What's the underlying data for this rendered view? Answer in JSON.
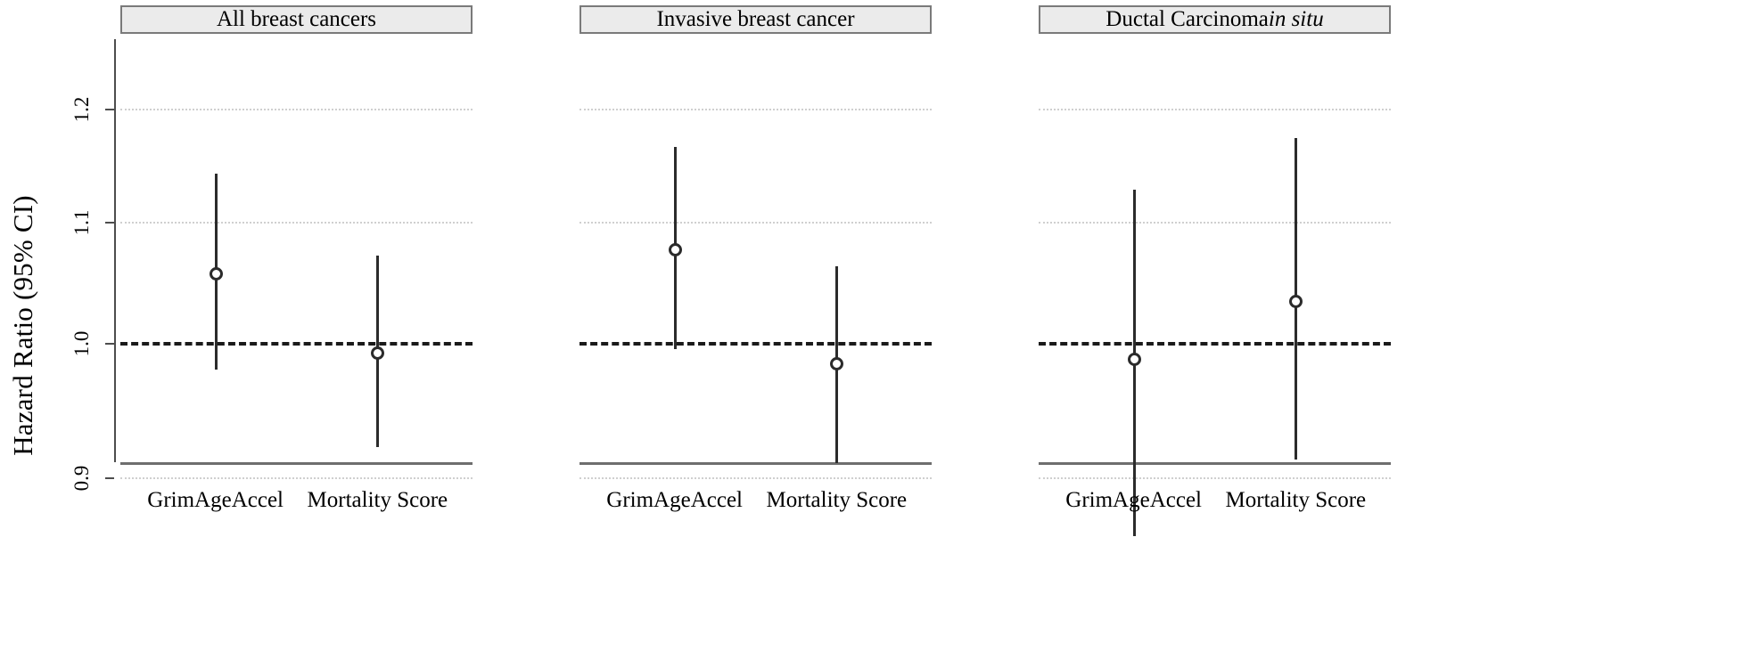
{
  "axis": {
    "ylabel": "Hazard Ratio (95% CI)",
    "yticks": [
      "1.2",
      "1.1",
      "1.0",
      "0.9"
    ],
    "ytick_values": [
      1.2,
      1.1,
      1.0,
      0.9
    ],
    "reference_line": 1.0,
    "reference_line_style": "dashed",
    "gridline_style": "dotted"
  },
  "panels": [
    {
      "id": "all-breast-cancers",
      "title_plain": "All breast cancers",
      "title_html": "All breast cancers"
    },
    {
      "id": "invasive-breast-cancer",
      "title_plain": "Invasive breast cancer",
      "title_html": "Invasive breast cancer"
    },
    {
      "id": "ductal-carcinoma-in-situ",
      "title_plain": "Ductal Carcinoma in situ",
      "title_html": "Ductal Carcinoma <em>in situ</em>"
    }
  ],
  "xcategories": [
    "GrimAgeAccel",
    "Mortality Score"
  ],
  "chart_data": {
    "type": "scatter",
    "subtype": "forest-plot",
    "title": "",
    "xlabel": "",
    "ylabel": "Hazard Ratio (95% CI)",
    "yscale": "log",
    "ylim": [
      0.83,
      1.27
    ],
    "yticks": [
      0.9,
      1.0,
      1.1,
      1.2
    ],
    "ytick_labels": [
      "0.9",
      "1.0",
      "1.1",
      "1.2"
    ],
    "grid": true,
    "grid_axis": "y",
    "legend": false,
    "reference_line": {
      "y": 1.0,
      "style": "dashed",
      "color": "#1a1a1a"
    },
    "marker": {
      "shape": "circle-open",
      "color": "#2b2b2b",
      "size": 15
    },
    "categories": [
      "GrimAgeAccel",
      "Mortality Score"
    ],
    "facets": [
      {
        "name": "All breast cancers",
        "points": [
          {
            "x": "GrimAgeAccel",
            "estimate": 1.057,
            "ci_low": 0.98,
            "ci_high": 1.142
          },
          {
            "x": "Mortality Score",
            "estimate": 0.993,
            "ci_low": 0.922,
            "ci_high": 1.072
          }
        ]
      },
      {
        "name": "Invasive breast cancer",
        "points": [
          {
            "x": "GrimAgeAccel",
            "estimate": 1.077,
            "ci_low": 0.996,
            "ci_high": 1.166
          },
          {
            "x": "Mortality Score",
            "estimate": 0.985,
            "ci_low": 0.911,
            "ci_high": 1.063
          }
        ]
      },
      {
        "name": "Ductal Carcinoma in situ",
        "points": [
          {
            "x": "GrimAgeAccel",
            "estimate": 0.988,
            "ci_low": 0.86,
            "ci_high": 1.128
          },
          {
            "x": "Mortality Score",
            "estimate": 1.034,
            "ci_low": 0.913,
            "ci_high": 1.174
          }
        ]
      }
    ]
  },
  "colors": {
    "panel_strip_bg": "#ebebeb",
    "panel_strip_border": "#7a7a7a",
    "marker": "#2b2b2b",
    "reference_line": "#1a1a1a",
    "gridline": "#cfcfcf",
    "axis": "#6e6e6e",
    "background": "#ffffff"
  }
}
